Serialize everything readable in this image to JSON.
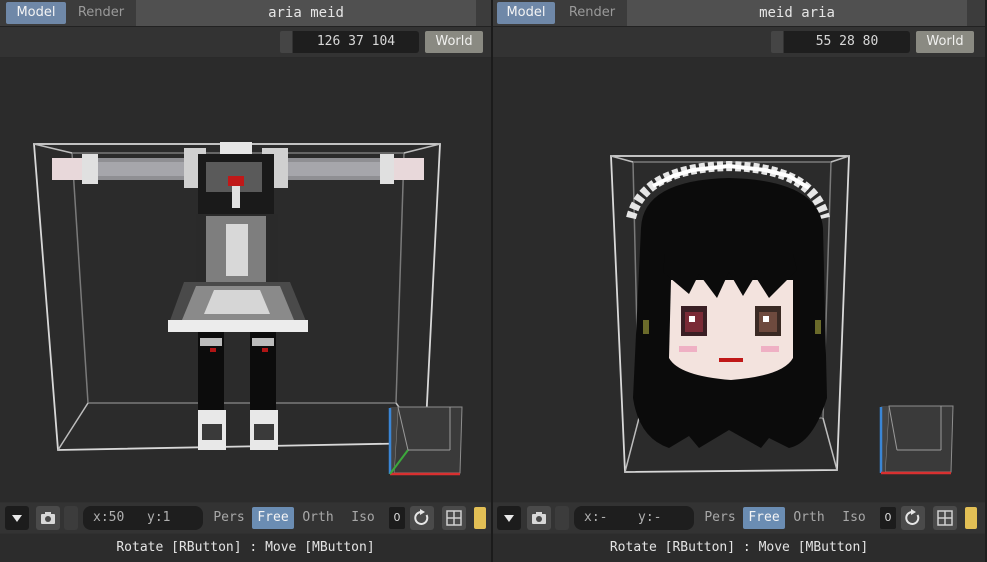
{
  "left": {
    "tabs": [
      {
        "label": "Model",
        "active": true
      },
      {
        "label": "Render",
        "active": false
      }
    ],
    "title": "aria meid",
    "dimensions": "126 37 104",
    "world_label": "World",
    "coords": {
      "x": "x:50",
      "y": "y:1"
    },
    "projection": [
      "Pers",
      "Free",
      "Orth",
      "Iso"
    ],
    "projection_active": "Free",
    "counter": "0",
    "status": "Rotate [RButton] : Move [MButton]"
  },
  "right": {
    "tabs": [
      {
        "label": "Model",
        "active": true
      },
      {
        "label": "Render",
        "active": false
      }
    ],
    "title": "meid aria",
    "dimensions": "55 28 80",
    "world_label": "World",
    "coords": {
      "x": "x:-",
      "y": "y:-"
    },
    "projection": [
      "Pers",
      "Free",
      "Orth",
      "Iso"
    ],
    "projection_active": "Free",
    "counter": "0",
    "status": "Rotate [RButton] : Move [MButton]"
  },
  "icons": {
    "menu": "triangle-down-icon",
    "camera": "camera-icon",
    "reset": "reset-rotate-icon",
    "grid": "grid-icon"
  },
  "colors": {
    "tab_active": "#6f88a8",
    "projection_active": "#6b8db3",
    "world_button": "#8a8a82",
    "accent_yellow": "#e2bf55",
    "axis_x": "#d93030",
    "axis_y": "#3ca83c",
    "axis_z": "#3a86d6"
  }
}
